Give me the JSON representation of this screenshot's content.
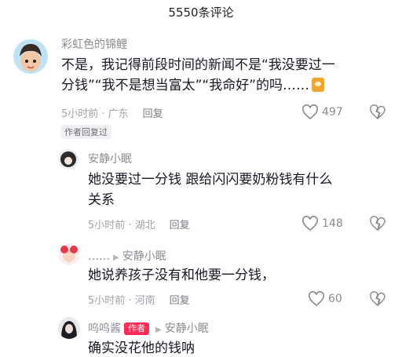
{
  "header": {
    "title": "5550条评论"
  },
  "comments": [
    {
      "username": "彩虹色的锦鲤",
      "text_line1": "不是，我记得前段时间的新闻不是“我没要过一",
      "text_line2": "分钱”“我不是想当富太”“我命好”的吗……",
      "time_location": "5小时前 · 广东",
      "reply_label": "回复",
      "likes": "497",
      "author_replied": "作者回复过",
      "emoji": "smiling-face-emoji"
    },
    {
      "username": "安静小眠",
      "text_line1": "她没要过一分钱 跟给闪闪要奶粉钱有什么",
      "text_line2": "关系",
      "time_location": "5小时前 · 湖北",
      "reply_label": "回复",
      "likes": "148"
    },
    {
      "username": "……",
      "reply_to": "安静小眠",
      "text_line1": "她说养孩子没有和他要一分钱，",
      "time_location": "5小时前 · 河南",
      "reply_label": "回复",
      "likes": "60"
    },
    {
      "username": "呜呜酱",
      "author_tag": "作者",
      "reply_to": "安静小眠",
      "text_line1": "确实没花他的钱呐"
    }
  ],
  "colors": {
    "like": "#8a8b91",
    "author_tag": "#fe2c55",
    "text": "#161823",
    "muted": "#a1a2a8"
  },
  "icons": {
    "like": "heart-outline-icon",
    "dislike": "broken-heart-icon",
    "reply_arrow": "triangle-right-icon"
  }
}
